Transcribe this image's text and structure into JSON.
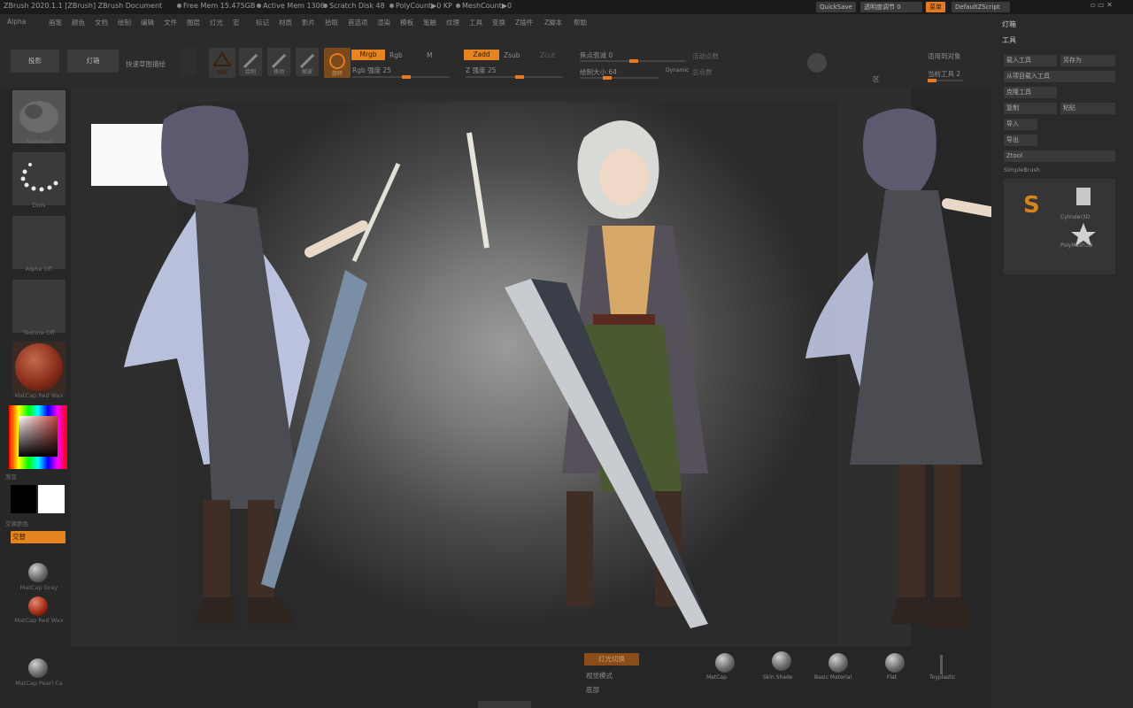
{
  "titlebar": {
    "app": "ZBrush 2020.1.1 [ZBrush]    ZBrush Document",
    "free_mem": "Free Mem 15.475GB",
    "active_mem": "Active Mem 1306",
    "scratch": "Scratch Disk 48",
    "polycount": "PolyCount▶0 KP",
    "meshcount": "MeshCount▶0",
    "quicksave": "QuickSave",
    "seethrough": "透明度调节 0",
    "menus_btn": "菜单",
    "default_script": "DefaultZScript"
  },
  "menubar": {
    "items": [
      "Alpha",
      "画笔",
      "颜色",
      "文档",
      "绘制",
      "编辑",
      "文件",
      "图层",
      "灯光",
      "宏",
      "标记",
      "材质",
      "影片",
      "拾取",
      "首选项",
      "渲染",
      "模板",
      "笔触",
      "纹理",
      "工具",
      "变换",
      "Z插件",
      "Z脚本",
      "帮助"
    ]
  },
  "shelf": {
    "projection_master": "投影",
    "lightbox": "灯箱",
    "quick_sketch": "快速草图描绘",
    "tools": [
      "编辑",
      "绘制",
      "移动",
      "缩放",
      "旋转"
    ],
    "mrgb": "Mrgb",
    "rgb": "Rgb",
    "m": "M",
    "rgb_intensity": "Rgb 强度 25",
    "zadd": "Zadd",
    "zsub": "Zsub",
    "zcut": "Zcut",
    "z_intensity": "Z 强度 25",
    "focal_shift": "焦点衰减 0",
    "draw_size": "绘制大小 64",
    "dynamic": "Dynamic",
    "active_points": "活动点数",
    "total_points": "总点数",
    "spotlight_projection": "聚光灯投影",
    "space_x": "区",
    "symmetry_label": "适用到对象",
    "apply_btn": "当前工具 2"
  },
  "leftpanel": {
    "brush_caption": "Standard",
    "stroke_caption": "Dots",
    "alpha_caption": "Alpha Off",
    "texture_caption": "Texture Off",
    "material_caption": "MatCap Red Wax",
    "gradient_label": "渐变",
    "switch_color_label": "交换颜色",
    "alternate_btn": "交替",
    "material_gray_caption": "MatCap Gray",
    "material_redwax_caption": "MatCap Red Wax",
    "material_pearl_caption": "MatCap Pearl Ca"
  },
  "rightpanel": {
    "header1": "灯箱",
    "header2": "工具",
    "rows": [
      "载入工具",
      "另存为",
      "从项目载入工具",
      "克隆工具",
      "复制",
      "粘贴",
      "导入",
      "导出",
      "Ztool"
    ],
    "subtool_label": "SimpleBrush",
    "tool_names": [
      "Cylinder3D",
      "PolyMesh3D"
    ]
  },
  "bottombar": {
    "lightbox_btn": "灯光切换",
    "materials": [
      "MatCap",
      "Skin Shade",
      "Basic Material",
      "Flat",
      "Toyplastic"
    ],
    "label1": "视觉模式",
    "label2": "底部"
  },
  "colors": {
    "accent": "#e8791e",
    "panel": "#2a2a2a",
    "canvas_center": "#9b9b9b"
  }
}
